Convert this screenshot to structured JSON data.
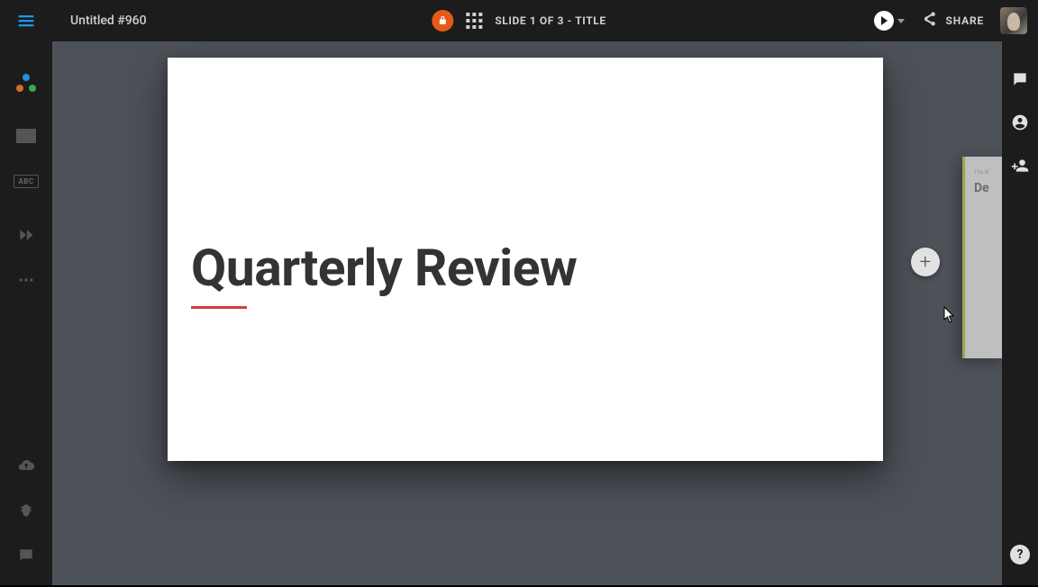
{
  "header": {
    "doc_title": "Untitled #960",
    "slide_indicator": "SLIDE 1 OF 3 - TITLE",
    "share_label": "SHARE"
  },
  "left_tools": {
    "abc_label": "ABC"
  },
  "slide": {
    "title": "Quarterly Review"
  },
  "peek": {
    "line1": "The W",
    "line2": "De"
  },
  "help": {
    "label": "?"
  },
  "add_slide": {
    "glyph": "+"
  }
}
